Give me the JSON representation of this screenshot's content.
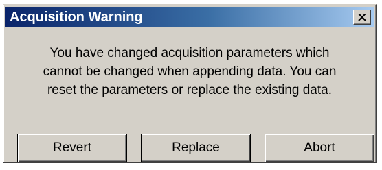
{
  "dialog": {
    "title": "Acquisition Warning",
    "close_icon": "close-x-icon",
    "message_lines": [
      "You have changed acquisition parameters which",
      "cannot be changed when appending data. You can",
      "reset the parameters or replace the existing data."
    ],
    "buttons": {
      "revert": "Revert",
      "replace": "Replace",
      "abort": "Abort"
    }
  },
  "colors": {
    "titlebar_start": "#0a246a",
    "titlebar_end": "#a6caf0",
    "face": "#d4d0c8"
  }
}
